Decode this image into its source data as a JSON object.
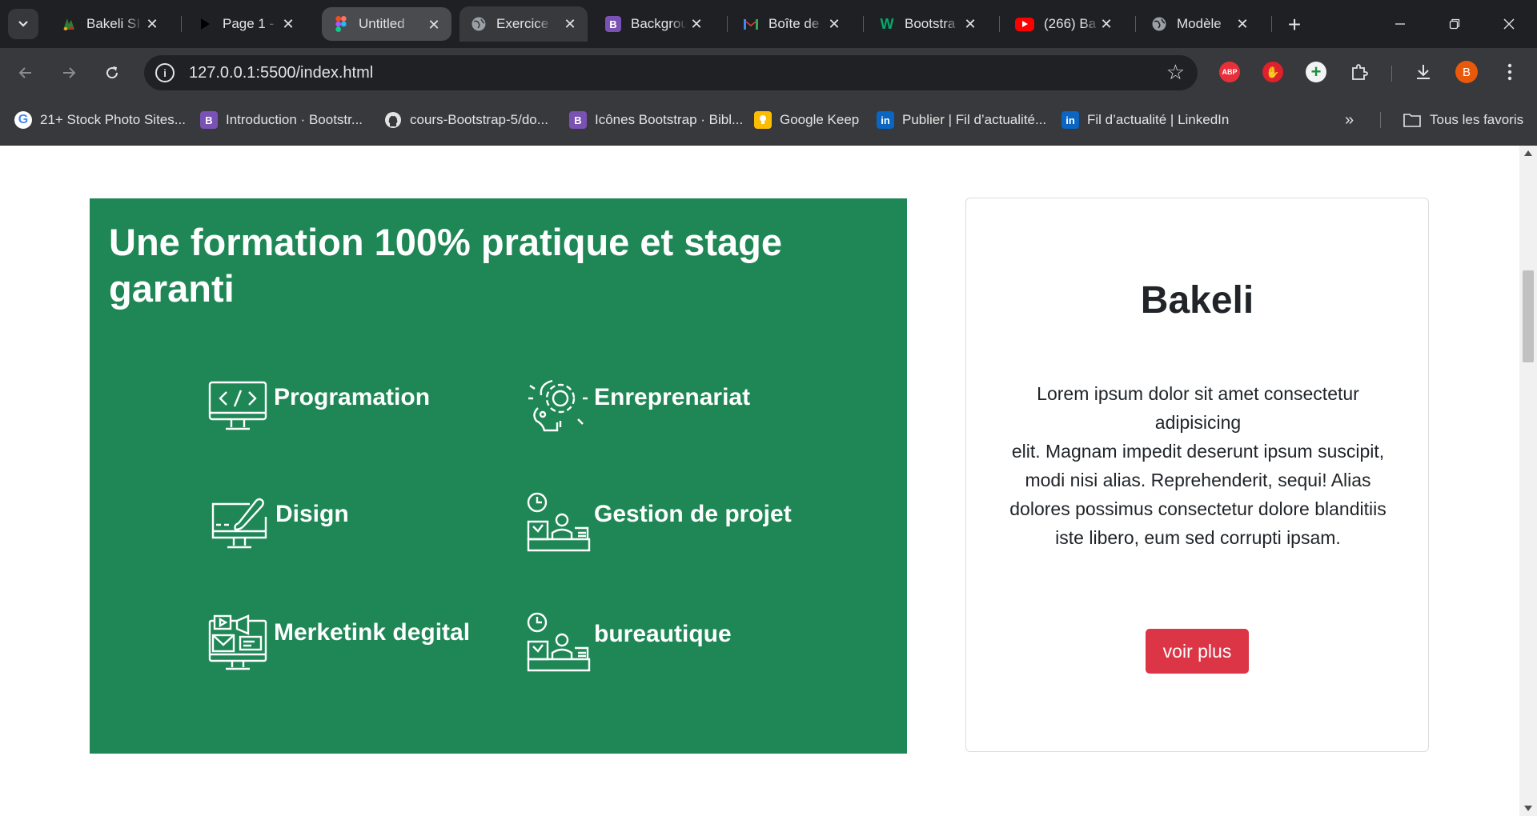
{
  "browser": {
    "tabs": [
      {
        "title": "Bakeli SI",
        "favicon": "bakeli-icon",
        "color": "#2e7d32"
      },
      {
        "title": "Page 1 -",
        "favicon": "play-icon",
        "color": "#000000"
      },
      {
        "title": "Untitled",
        "favicon": "figma-icon",
        "color": "#a259ff"
      },
      {
        "title": "Exercice",
        "favicon": "globe-icon",
        "color": "#9aa0a6"
      },
      {
        "title": "Backgrou",
        "favicon": "bootstrap-icon",
        "color": "#7952b3"
      },
      {
        "title": "Boîte de",
        "favicon": "gmail-icon",
        "color": "#ea4335"
      },
      {
        "title": "Bootstra",
        "favicon": "w3-icon",
        "color": "#04aa6d"
      },
      {
        "title": "(266) Ba",
        "favicon": "youtube-icon",
        "color": "#ff0000"
      },
      {
        "title": "Modèle",
        "favicon": "globe-icon",
        "color": "#9aa0a6"
      }
    ],
    "url": "127.0.0.1:5500/index.html",
    "avatar_letter": "B",
    "abp_label": "ABP",
    "bookmarks": [
      {
        "label": "21+ Stock Photo Sites...",
        "icon": "google-icon"
      },
      {
        "label": "Introduction · Bootstr...",
        "icon": "bootstrap-icon"
      },
      {
        "label": "cours-Bootstrap-5/do...",
        "icon": "github-icon"
      },
      {
        "label": "Icônes Bootstrap · Bibl...",
        "icon": "bootstrap-icon"
      },
      {
        "label": "Google Keep",
        "icon": "keep-icon"
      },
      {
        "label": "Publier | Fil d’actualité...",
        "icon": "linkedin-icon"
      },
      {
        "label": "Fil d’actualité | LinkedIn",
        "icon": "linkedin-icon"
      }
    ],
    "all_bookmarks_label": "Tous les favoris"
  },
  "page": {
    "panel_title": "Une formation 100% pratique et stage garanti",
    "panel_color": "#1e8755",
    "features": [
      {
        "label": "Programation",
        "icon": "code-monitor-icon"
      },
      {
        "label": "Enreprenariat",
        "icon": "gear-head-icon"
      },
      {
        "label": "Disign",
        "icon": "design-monitor-icon"
      },
      {
        "label": "Gestion de projet",
        "icon": "project-management-icon"
      },
      {
        "label": "Merketink degital",
        "icon": "digital-marketing-icon"
      },
      {
        "label": "bureautique",
        "icon": "office-icon"
      }
    ],
    "card": {
      "title": "Bakeli",
      "text_line1": "Lorem ipsum dolor sit amet consectetur adipisicing",
      "text_line2": "elit. Magnam impedit deserunt ipsum suscipit, modi nisi alias. Reprehenderit, sequi! Alias dolores possimus consectetur dolore blanditiis iste libero, eum sed corrupti ipsam.",
      "button_label": "voir plus",
      "button_color": "#dc3545"
    }
  }
}
